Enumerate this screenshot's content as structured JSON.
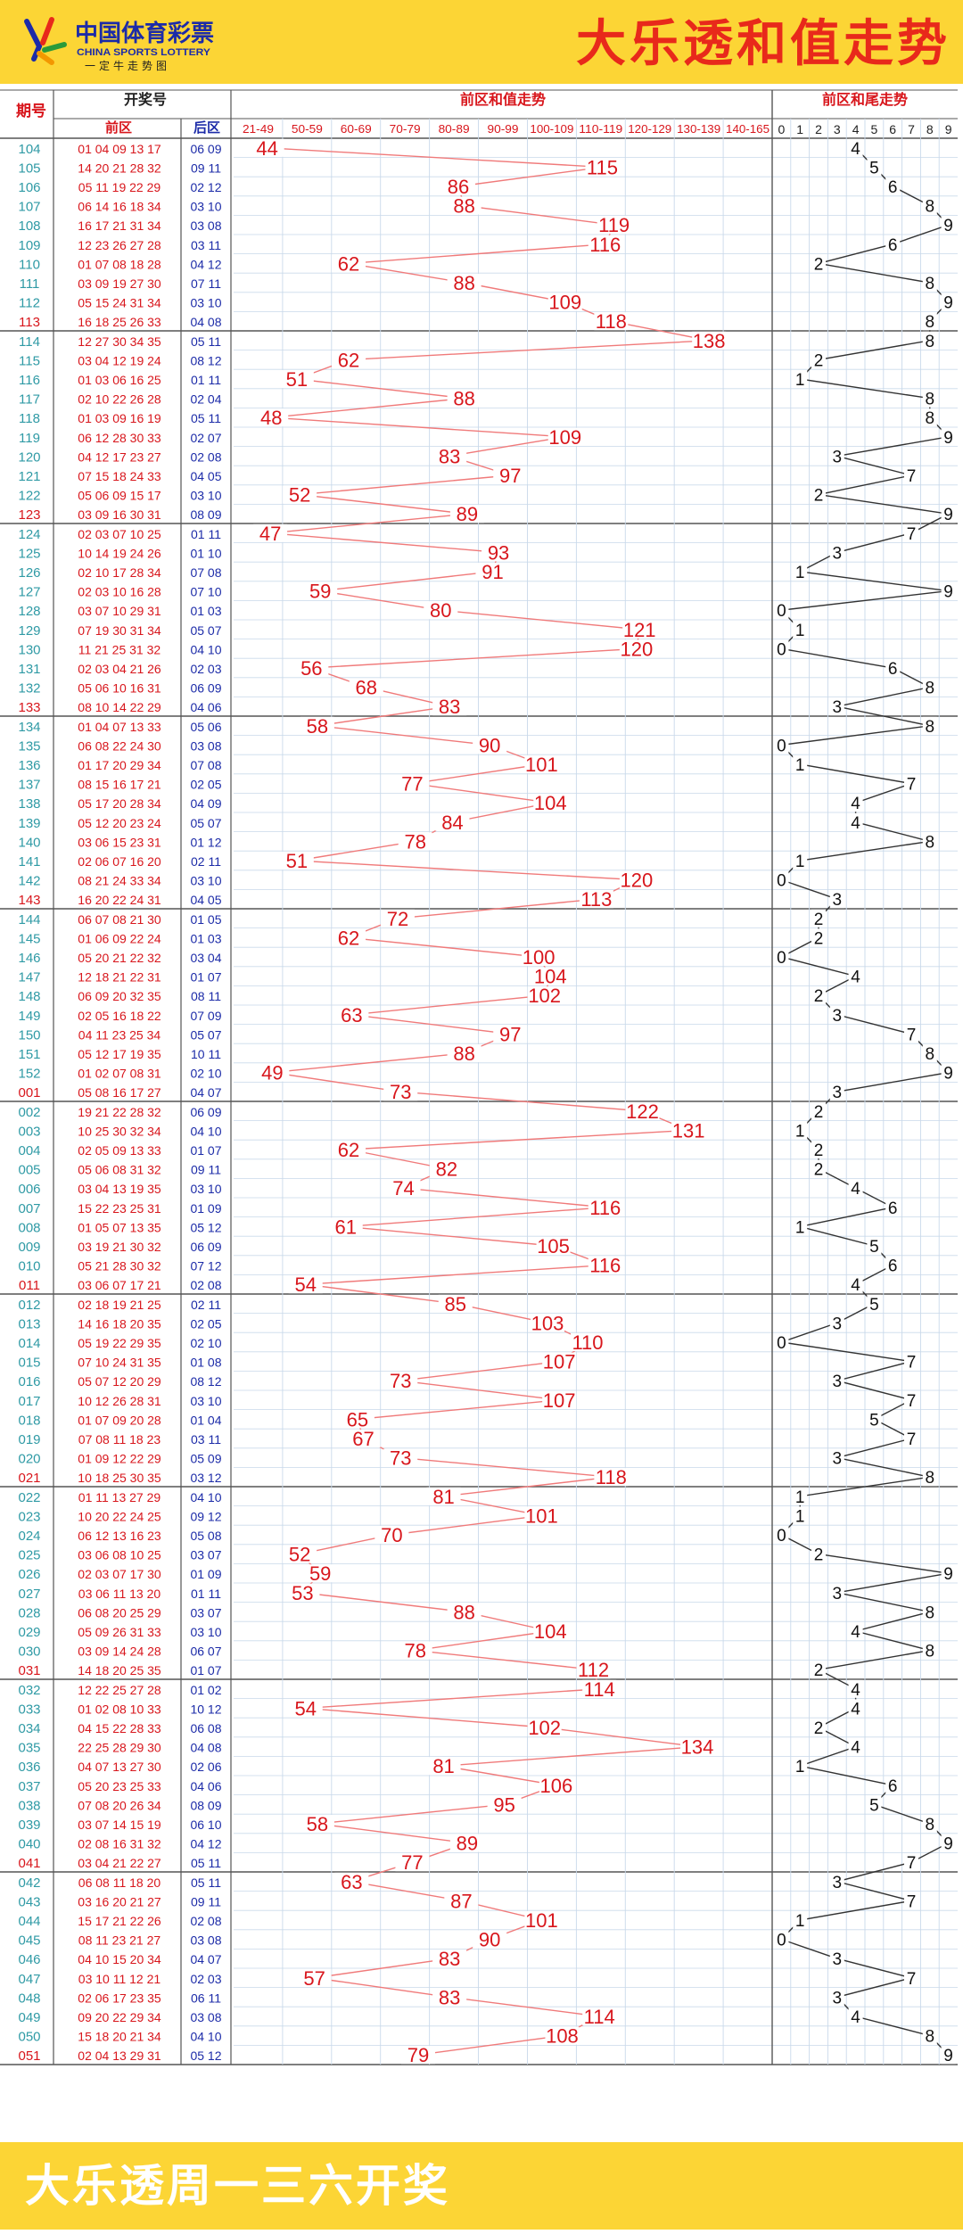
{
  "header": {
    "logo_cn": "中国体育彩票",
    "logo_en": "CHINA SPORTS LOTTERY",
    "logo_slogan": "一定牛走势图",
    "title": "大乐透和值走势"
  },
  "table_headers": {
    "period": "期号",
    "draw_numbers": "开奖号",
    "front": "前区",
    "back": "后区",
    "sum_trend": "前区和值走势",
    "tail_trend": "前区和尾走势"
  },
  "sum_bins": [
    "21-49",
    "50-59",
    "60-69",
    "70-79",
    "80-89",
    "90-99",
    "100-109",
    "110-119",
    "120-129",
    "130-139",
    "140-165"
  ],
  "tail_bins": [
    "0",
    "1",
    "2",
    "3",
    "4",
    "5",
    "6",
    "7",
    "8",
    "9"
  ],
  "footer": {
    "text": "大乐透周一三六开奖"
  },
  "colors": {
    "header_bg": "#fcd535",
    "title_red": "#e8291b",
    "period_teal": "#2f9aa5",
    "period_red": "#d8161c",
    "front_red": "#d8161c",
    "back_blue": "#1c2ba8",
    "sum_line": "#f07a7a",
    "tail_line": "#333333",
    "grid": "#c9d9ea",
    "major_grid": "#555555"
  },
  "chart_data": {
    "type": "table",
    "series": [
      {
        "name": "前区和值走势",
        "type": "line"
      },
      {
        "name": "前区和尾走势",
        "type": "line"
      }
    ],
    "rows": [
      {
        "period": "104",
        "front": "01 04 09 13 17",
        "back": "06 09",
        "sum": 44
      },
      {
        "period": "105",
        "front": "14 20 21 28 32",
        "back": "09 11",
        "sum": 115
      },
      {
        "period": "106",
        "front": "05 11 19 22 29",
        "back": "02 12",
        "sum": 86
      },
      {
        "period": "107",
        "front": "06 14 16 18 34",
        "back": "03 10",
        "sum": 88
      },
      {
        "period": "108",
        "front": "16 17 21 31 34",
        "back": "03 08",
        "sum": 119
      },
      {
        "period": "109",
        "front": "12 23 26 27 28",
        "back": "03 11",
        "sum": 116
      },
      {
        "period": "110",
        "front": "01 07 08 18 28",
        "back": "04 12",
        "sum": 62
      },
      {
        "period": "111",
        "front": "03 09 19 27 30",
        "back": "07 11",
        "sum": 88
      },
      {
        "period": "112",
        "front": "05 15 24 31 34",
        "back": "03 10",
        "sum": 109
      },
      {
        "period": "113",
        "front": "16 18 25 26 33",
        "back": "04 08",
        "sum": 118
      },
      {
        "period": "114",
        "front": "12 27 30 34 35",
        "back": "05 11",
        "sum": 138
      },
      {
        "period": "115",
        "front": "03 04 12 19 24",
        "back": "08 12",
        "sum": 62
      },
      {
        "period": "116",
        "front": "01 03 06 16 25",
        "back": "01 11",
        "sum": 51
      },
      {
        "period": "117",
        "front": "02 10 22 26 28",
        "back": "02 04",
        "sum": 88
      },
      {
        "period": "118",
        "front": "01 03 09 16 19",
        "back": "05 11",
        "sum": 48
      },
      {
        "period": "119",
        "front": "06 12 28 30 33",
        "back": "02 07",
        "sum": 109
      },
      {
        "period": "120",
        "front": "04 12 17 23 27",
        "back": "02 08",
        "sum": 83
      },
      {
        "period": "121",
        "front": "07 15 18 24 33",
        "back": "04 05",
        "sum": 97
      },
      {
        "period": "122",
        "front": "05 06 09 15 17",
        "back": "03 10",
        "sum": 52
      },
      {
        "period": "123",
        "front": "03 09 16 30 31",
        "back": "08 09",
        "sum": 89
      },
      {
        "period": "124",
        "front": "02 03 07 10 25",
        "back": "01 11",
        "sum": 47
      },
      {
        "period": "125",
        "front": "10 14 19 24 26",
        "back": "01 10",
        "sum": 93
      },
      {
        "period": "126",
        "front": "02 10 17 28 34",
        "back": "07 08",
        "sum": 91
      },
      {
        "period": "127",
        "front": "02 03 10 16 28",
        "back": "07 10",
        "sum": 59
      },
      {
        "period": "128",
        "front": "03 07 10 29 31",
        "back": "01 03",
        "sum": 80
      },
      {
        "period": "129",
        "front": "07 19 30 31 34",
        "back": "05 07",
        "sum": 121
      },
      {
        "period": "130",
        "front": "11 21 25 31 32",
        "back": "04 10",
        "sum": 120
      },
      {
        "period": "131",
        "front": "02 03 04 21 26",
        "back": "02 03",
        "sum": 56
      },
      {
        "period": "132",
        "front": "05 06 10 16 31",
        "back": "06 09",
        "sum": 68
      },
      {
        "period": "133",
        "front": "08 10 14 22 29",
        "back": "04 06",
        "sum": 83
      },
      {
        "period": "134",
        "front": "01 04 07 13 33",
        "back": "05 06",
        "sum": 58
      },
      {
        "period": "135",
        "front": "06 08 22 24 30",
        "back": "03 08",
        "sum": 90
      },
      {
        "period": "136",
        "front": "01 17 20 29 34",
        "back": "07 08",
        "sum": 101
      },
      {
        "period": "137",
        "front": "08 15 16 17 21",
        "back": "02 05",
        "sum": 77
      },
      {
        "period": "138",
        "front": "05 17 20 28 34",
        "back": "04 09",
        "sum": 104
      },
      {
        "period": "139",
        "front": "05 12 20 23 24",
        "back": "05 07",
        "sum": 84
      },
      {
        "period": "140",
        "front": "03 06 15 23 31",
        "back": "01 12",
        "sum": 78
      },
      {
        "period": "141",
        "front": "02 06 07 16 20",
        "back": "02 11",
        "sum": 51
      },
      {
        "period": "142",
        "front": "08 21 24 33 34",
        "back": "03 10",
        "sum": 120
      },
      {
        "period": "143",
        "front": "16 20 22 24 31",
        "back": "04 05",
        "sum": 113
      },
      {
        "period": "144",
        "front": "06 07 08 21 30",
        "back": "01 05",
        "sum": 72
      },
      {
        "period": "145",
        "front": "01 06 09 22 24",
        "back": "01 03",
        "sum": 62
      },
      {
        "period": "146",
        "front": "05 20 21 22 32",
        "back": "03 04",
        "sum": 100
      },
      {
        "period": "147",
        "front": "12 18 21 22 31",
        "back": "01 07",
        "sum": 104
      },
      {
        "period": "148",
        "front": "06 09 20 32 35",
        "back": "08 11",
        "sum": 102
      },
      {
        "period": "149",
        "front": "02 05 16 18 22",
        "back": "07 09",
        "sum": 63
      },
      {
        "period": "150",
        "front": "04 11 23 25 34",
        "back": "05 07",
        "sum": 97
      },
      {
        "period": "151",
        "front": "05 12 17 19 35",
        "back": "10 11",
        "sum": 88
      },
      {
        "period": "152",
        "front": "01 02 07 08 31",
        "back": "02 10",
        "sum": 49
      },
      {
        "period": "001",
        "front": "05 08 16 17 27",
        "back": "04 07",
        "sum": 73
      },
      {
        "period": "002",
        "front": "19 21 22 28 32",
        "back": "06 09",
        "sum": 122
      },
      {
        "period": "003",
        "front": "10 25 30 32 34",
        "back": "04 10",
        "sum": 131
      },
      {
        "period": "004",
        "front": "02 05 09 13 33",
        "back": "01 07",
        "sum": 62
      },
      {
        "period": "005",
        "front": "05 06 08 31 32",
        "back": "09 11",
        "sum": 82
      },
      {
        "period": "006",
        "front": "03 04 13 19 35",
        "back": "03 10",
        "sum": 74
      },
      {
        "period": "007",
        "front": "15 22 23 25 31",
        "back": "01 09",
        "sum": 116
      },
      {
        "period": "008",
        "front": "01 05 07 13 35",
        "back": "05 12",
        "sum": 61
      },
      {
        "period": "009",
        "front": "03 19 21 30 32",
        "back": "06 09",
        "sum": 105
      },
      {
        "period": "010",
        "front": "05 21 28 30 32",
        "back": "07 12",
        "sum": 116
      },
      {
        "period": "011",
        "front": "03 06 07 17 21",
        "back": "02 08",
        "sum": 54
      },
      {
        "period": "012",
        "front": "02 18 19 21 25",
        "back": "02 11",
        "sum": 85
      },
      {
        "period": "013",
        "front": "14 16 18 20 35",
        "back": "02 05",
        "sum": 103
      },
      {
        "period": "014",
        "front": "05 19 22 29 35",
        "back": "02 10",
        "sum": 110
      },
      {
        "period": "015",
        "front": "07 10 24 31 35",
        "back": "01 08",
        "sum": 107
      },
      {
        "period": "016",
        "front": "05 07 12 20 29",
        "back": "08 12",
        "sum": 73
      },
      {
        "period": "017",
        "front": "10 12 26 28 31",
        "back": "03 10",
        "sum": 107
      },
      {
        "period": "018",
        "front": "01 07 09 20 28",
        "back": "01 04",
        "sum": 65
      },
      {
        "period": "019",
        "front": "07 08 11 18 23",
        "back": "03 11",
        "sum": 67
      },
      {
        "period": "020",
        "front": "01 09 12 22 29",
        "back": "05 09",
        "sum": 73
      },
      {
        "period": "021",
        "front": "10 18 25 30 35",
        "back": "03 12",
        "sum": 118
      },
      {
        "period": "022",
        "front": "01 11 13 27 29",
        "back": "04 10",
        "sum": 81
      },
      {
        "period": "023",
        "front": "10 20 22 24 25",
        "back": "09 12",
        "sum": 101
      },
      {
        "period": "024",
        "front": "06 12 13 16 23",
        "back": "05 08",
        "sum": 70
      },
      {
        "period": "025",
        "front": "03 06 08 10 25",
        "back": "03 07",
        "sum": 52
      },
      {
        "period": "026",
        "front": "02 03 07 17 30",
        "back": "01 09",
        "sum": 59
      },
      {
        "period": "027",
        "front": "03 06 11 13 20",
        "back": "01 11",
        "sum": 53
      },
      {
        "period": "028",
        "front": "06 08 20 25 29",
        "back": "03 07",
        "sum": 88
      },
      {
        "period": "029",
        "front": "05 09 26 31 33",
        "back": "03 10",
        "sum": 104
      },
      {
        "period": "030",
        "front": "03 09 14 24 28",
        "back": "06 07",
        "sum": 78
      },
      {
        "period": "031",
        "front": "14 18 20 25 35",
        "back": "01 07",
        "sum": 112
      },
      {
        "period": "032",
        "front": "12 22 25 27 28",
        "back": "01 02",
        "sum": 114
      },
      {
        "period": "033",
        "front": "01 02 08 10 33",
        "back": "10 12",
        "sum": 54
      },
      {
        "period": "034",
        "front": "04 15 22 28 33",
        "back": "06 08",
        "sum": 102
      },
      {
        "period": "035",
        "front": "22 25 28 29 30",
        "back": "04 08",
        "sum": 134
      },
      {
        "period": "036",
        "front": "04 07 13 27 30",
        "back": "02 06",
        "sum": 81
      },
      {
        "period": "037",
        "front": "05 20 23 25 33",
        "back": "04 06",
        "sum": 106
      },
      {
        "period": "038",
        "front": "07 08 20 26 34",
        "back": "08 09",
        "sum": 95
      },
      {
        "period": "039",
        "front": "03 07 14 15 19",
        "back": "06 10",
        "sum": 58
      },
      {
        "period": "040",
        "front": "02 08 16 31 32",
        "back": "04 12",
        "sum": 89
      },
      {
        "period": "041",
        "front": "03 04 21 22 27",
        "back": "05 11",
        "sum": 77
      },
      {
        "period": "042",
        "front": "06 08 11 18 20",
        "back": "05 11",
        "sum": 63
      },
      {
        "period": "043",
        "front": "03 16 20 21 27",
        "back": "09 11",
        "sum": 87
      },
      {
        "period": "044",
        "front": "15 17 21 22 26",
        "back": "02 08",
        "sum": 101
      },
      {
        "period": "045",
        "front": "08 11 23 21 27",
        "back": "03 08",
        "sum": 90
      },
      {
        "period": "046",
        "front": "04 10 15 20 34",
        "back": "04 07",
        "sum": 83
      },
      {
        "period": "047",
        "front": "03 10 11 12 21",
        "back": "02 03",
        "sum": 57
      },
      {
        "period": "048",
        "front": "02 06 17 23 35",
        "back": "06 11",
        "sum": 83
      },
      {
        "period": "049",
        "front": "09 20 22 29 34",
        "back": "03 08",
        "sum": 114
      },
      {
        "period": "050",
        "front": "15 18 20 21 34",
        "back": "04 10",
        "sum": 108
      },
      {
        "period": "051",
        "front": "02 04 13 29 31",
        "back": "05 12",
        "sum": 79
      }
    ]
  }
}
